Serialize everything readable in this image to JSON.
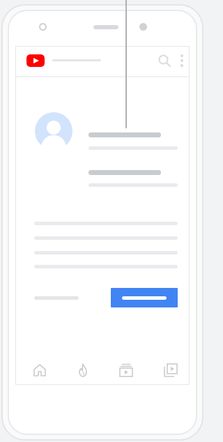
{
  "app": {
    "brand": "YouTube",
    "brand_color": "#ff0000",
    "accent_color": "#4184f3",
    "placeholder_color": "#e3e5e8"
  },
  "app_bar": {
    "logo_icon": "youtube-logo-icon",
    "search_icon": "search-icon",
    "more_icon": "more-vertical-icon"
  },
  "profile": {
    "avatar_icon": "user-avatar-icon",
    "avatar_color": "#d2e3fc"
  },
  "actions": {
    "secondary": "",
    "primary": ""
  },
  "bottom_nav": [
    {
      "icon": "home-icon"
    },
    {
      "icon": "trending-icon"
    },
    {
      "icon": "subscriptions-icon"
    },
    {
      "icon": "library-icon"
    }
  ]
}
